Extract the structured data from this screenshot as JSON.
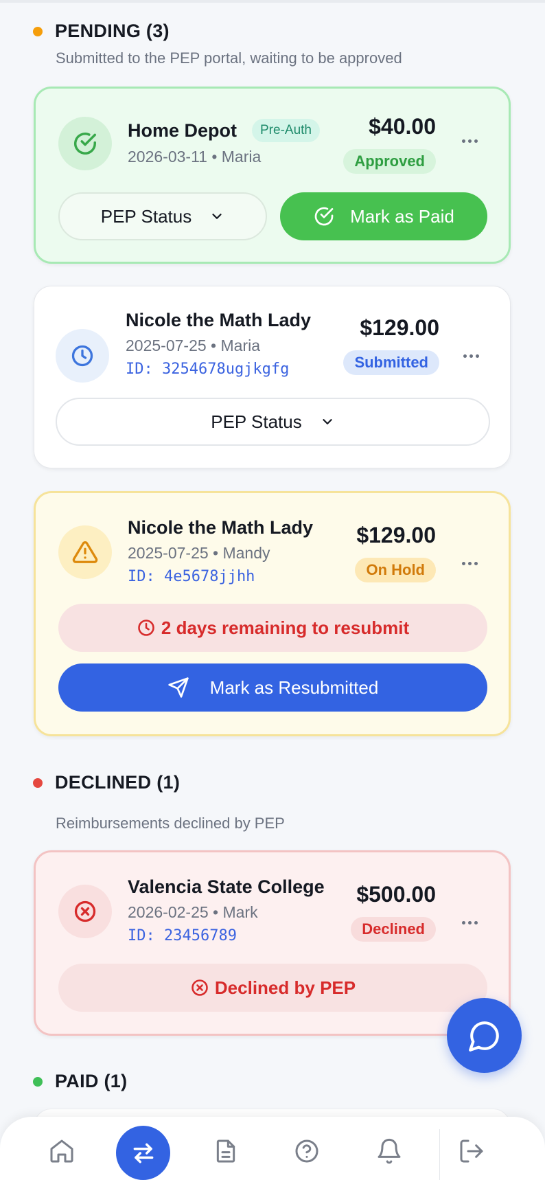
{
  "colors": {
    "accent_blue": "#3363e2",
    "pending_dot": "#f59e0b",
    "declined_dot": "#e5483f",
    "paid_dot": "#3fbf57",
    "green": "#47c150",
    "red": "#d72b2b",
    "amber": "#d97706"
  },
  "sections": {
    "pending": {
      "title": "PENDING (3)",
      "subtitle": "Submitted to the PEP portal, waiting to be approved"
    },
    "declined": {
      "title": "DECLINED (1)",
      "subtitle": "Reimbursements declined by PEP"
    },
    "paid": {
      "title": "PAID (1)"
    }
  },
  "cards": [
    {
      "icon": "check-circle-icon",
      "name": "Home Depot",
      "tag": "Pre-Auth",
      "meta": "2026-03-11 • Maria",
      "amount": "$40.00",
      "status": "Approved",
      "status_label": "PEP Status",
      "action": "Mark as Paid"
    },
    {
      "icon": "clock-icon",
      "name": "Nicole the Math Lady",
      "meta": "2025-07-25 • Maria",
      "id": "ID: 3254678ugjkgfg",
      "amount": "$129.00",
      "status": "Submitted",
      "status_label": "PEP Status"
    },
    {
      "icon": "warning-icon",
      "name": "Nicole the Math Lady",
      "meta": "2025-07-25 • Mandy",
      "id": "ID: 4e5678jjhh",
      "amount": "$129.00",
      "status": "On Hold",
      "alert": "2 days remaining to resubmit",
      "action": "Mark as Resubmitted"
    },
    {
      "icon": "x-circle-icon",
      "name": "Valencia State College",
      "meta": "2026-02-25 • Mark",
      "id": "ID: 23456789",
      "amount": "$500.00",
      "status": "Declined",
      "alert": "Declined by PEP"
    }
  ],
  "nav": [
    "home-icon",
    "transfer-icon",
    "document-icon",
    "help-icon",
    "bell-icon",
    "logout-icon"
  ],
  "nav_active": "transfer-icon"
}
